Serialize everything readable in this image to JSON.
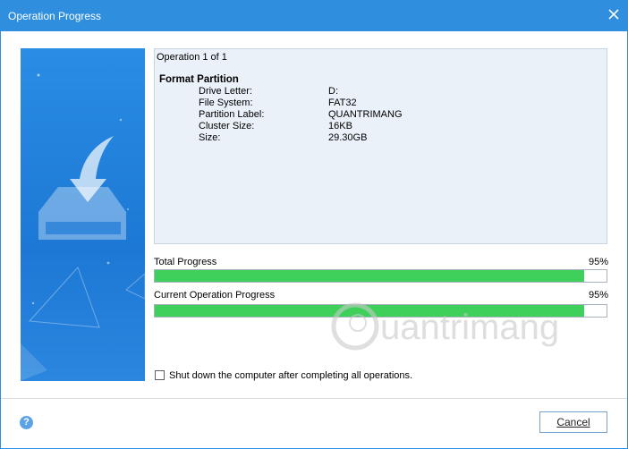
{
  "window": {
    "title": "Operation Progress"
  },
  "operation": {
    "count_label": "Operation 1 of 1",
    "title": "Format Partition",
    "fields": [
      {
        "label": "Drive Letter:",
        "value": "D:"
      },
      {
        "label": "File System:",
        "value": "FAT32"
      },
      {
        "label": "Partition Label:",
        "value": "QUANTRIMANG"
      },
      {
        "label": "Cluster Size:",
        "value": "16KB"
      },
      {
        "label": "Size:",
        "value": "29.30GB"
      }
    ]
  },
  "total_progress": {
    "label": "Total Progress",
    "percent_text": "95%",
    "percent": 95
  },
  "current_progress": {
    "label": "Current Operation Progress",
    "percent_text": "95%",
    "percent": 95
  },
  "shutdown_option": {
    "label": "Shut down the computer after completing all operations.",
    "checked": false
  },
  "buttons": {
    "cancel": "Cancel"
  },
  "watermark": {
    "text": "uantrimang"
  },
  "colors": {
    "titlebar": "#2f8fde",
    "progress_fill": "#3ed05a",
    "side_art": "#1c78d4"
  },
  "icons": {
    "close": "close-icon",
    "help": "help-icon",
    "download_drive": "download-drive-icon"
  }
}
